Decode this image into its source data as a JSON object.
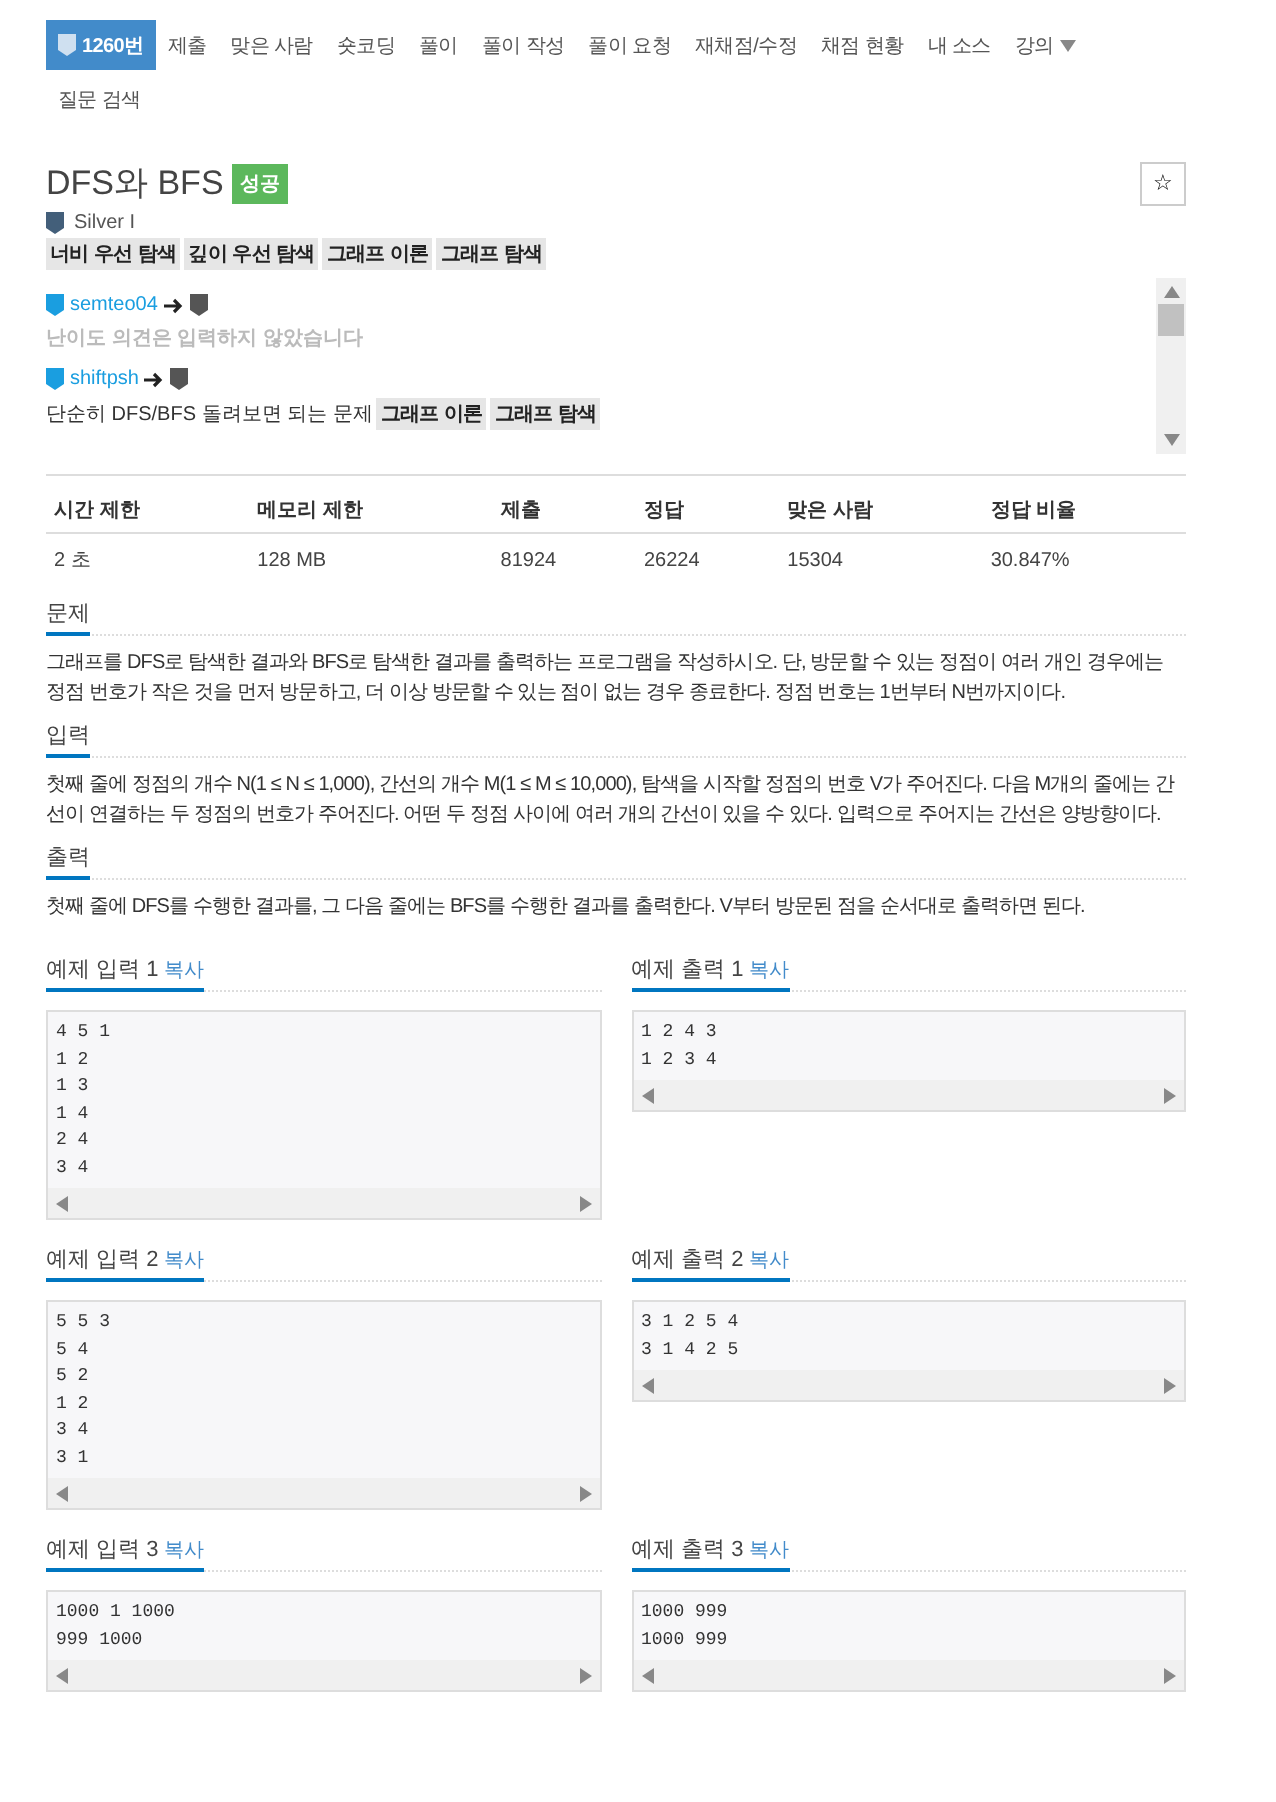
{
  "nav": {
    "items": [
      {
        "label": "1260번",
        "selected": true,
        "kind": "problem"
      },
      {
        "label": "제출",
        "selected": false
      },
      {
        "label": "맞은 사람",
        "selected": false
      },
      {
        "label": "숏코딩",
        "selected": false
      },
      {
        "label": "풀이",
        "selected": false
      },
      {
        "label": "풀이 작성",
        "selected": false
      },
      {
        "label": "풀이 요청",
        "selected": false
      },
      {
        "label": "재채점/수정",
        "selected": false
      },
      {
        "label": "채점 현황",
        "selected": false
      },
      {
        "label": "내 소스",
        "selected": false
      },
      {
        "label": "강의",
        "selected": false,
        "kind": "dropdown"
      },
      {
        "label": "질문 검색",
        "selected": false
      }
    ]
  },
  "problem": {
    "title": "DFS와 BFS",
    "result": "성공",
    "star": "☆",
    "tier": "Silver I",
    "tags": [
      "너비 우선 탐색",
      "깊이 우선 탐색",
      "그래프 이론",
      "그래프 탐색"
    ]
  },
  "opinions": [
    {
      "user": "semteo04",
      "text": "난이도 의견은 입력하지 않았습니다",
      "muted": true
    },
    {
      "user": "shiftpsh",
      "text": "단순히 DFS/BFS 돌려보면 되는 문제",
      "muted": false,
      "tags": [
        "그래프 이론",
        "그래프 탐색"
      ]
    }
  ],
  "table": {
    "columns": [
      "시간 제한",
      "메모리 제한",
      "제출",
      "정답",
      "맞은 사람",
      "정답 비율"
    ],
    "rows": [
      [
        "2 초",
        "128 MB",
        "81924",
        "26224",
        "15304",
        "30.847%"
      ]
    ]
  },
  "sections": [
    {
      "heading": "문제",
      "text": "그래프를 DFS로 탐색한 결과와 BFS로 탐색한 결과를 출력하는 프로그램을 작성하시오. 단, 방문할 수 있는 정점이 여러 개인 경우에는 정점 번호가 작은 것을 먼저 방문하고, 더 이상 방문할 수 있는 점이 없는 경우 종료한다. 정점 번호는 1번부터 N번까지이다."
    },
    {
      "heading": "입력",
      "text": "첫째 줄에 정점의 개수 N(1 ≤ N ≤ 1,000), 간선의 개수 M(1 ≤ M ≤ 10,000), 탐색을 시작할 정점의 번호 V가 주어진다. 다음 M개의 줄에는 간선이 연결하는 두 정점의 번호가 주어진다. 어떤 두 정점 사이에 여러 개의 간선이 있을 수 있다. 입력으로 주어지는 간선은 양방향이다."
    },
    {
      "heading": "출력",
      "text": "첫째 줄에 DFS를 수행한 결과를, 그 다음 줄에는 BFS를 수행한 결과를 출력한다. V부터 방문된 점을 순서대로 출력하면 된다."
    }
  ],
  "samples": [
    {
      "input_title": "예제 입력 1",
      "input_copy": "복사",
      "input": [
        "4 5 1",
        "1 2",
        "1 3",
        "1 4",
        "2 4",
        "3 4"
      ],
      "output_title": "예제 출력 1",
      "output_copy": "복사",
      "output": [
        "1 2 4 3",
        "1 2 3 4"
      ]
    },
    {
      "input_title": "예제 입력 2",
      "input_copy": "복사",
      "input": [
        "5 5 3",
        "5 4",
        "5 2",
        "1 2",
        "3 4",
        "3 1"
      ],
      "output_title": "예제 출력 2",
      "output_copy": "복사",
      "output": [
        "3 1 2 5 4",
        "3 1 4 2 5"
      ]
    },
    {
      "input_title": "예제 입력 3",
      "input_copy": "복사",
      "input": [
        "1000 1 1000",
        "999 1000"
      ],
      "output_title": "예제 출력 3",
      "output_copy": "복사",
      "output": [
        "1000 999",
        "1000 999"
      ]
    }
  ]
}
